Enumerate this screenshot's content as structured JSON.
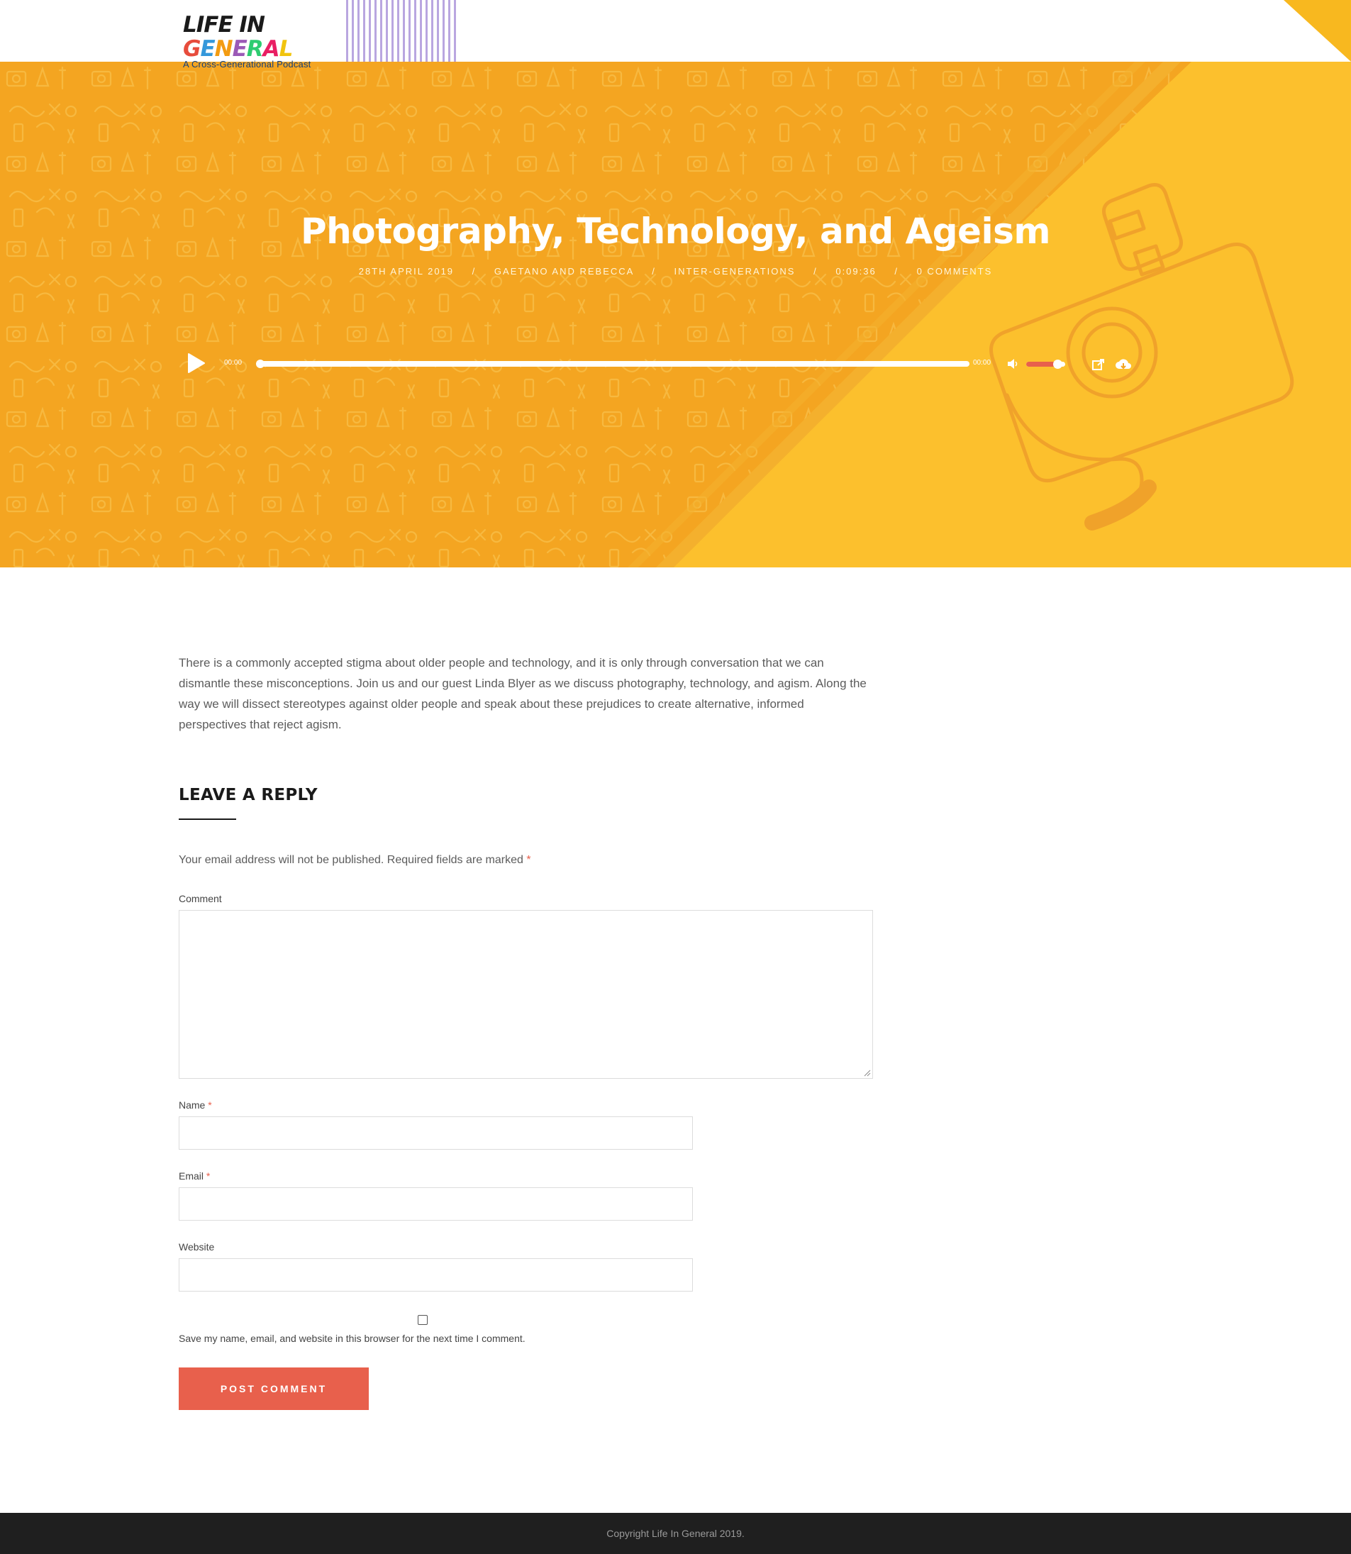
{
  "header": {
    "logo_title_parts": [
      "LIFE IN ",
      "G",
      "E",
      "N",
      "E",
      "R",
      "A",
      "L"
    ],
    "logo_subtitle": "A Cross-Generational Podcast"
  },
  "hero": {
    "title": "Photography, Technology, and Ageism",
    "meta": [
      "28TH APRIL 2019",
      "GAETANO AND REBECCA",
      "INTER-GENERATIONS",
      "0:09:36",
      "0 COMMENTS"
    ],
    "meta_separator": "/"
  },
  "player": {
    "current_time": "00:00",
    "duration": "00:00",
    "progress": 0,
    "volume": 0.8,
    "icons": [
      "play-icon",
      "mute-icon",
      "external-link-icon",
      "download-cloud-icon"
    ]
  },
  "post": {
    "intro": "There is a commonly accepted stigma about older people and technology, and it is only through conversation that we can dismantle these misconceptions. Join us and our guest Linda Blyer as we discuss photography, technology, and agism. Along the way we will dissect stereotypes against older people and speak about these prejudices to create alternative, informed perspectives that reject agism."
  },
  "reply": {
    "title": "LEAVE A REPLY",
    "notice": "Your email address will not be published. Required fields are marked",
    "required_mark": "*",
    "comment_label": "Comment",
    "comment_value": "",
    "name_label": "Name",
    "name_value": "",
    "email_label": "Email",
    "email_value": "",
    "website_label": "Website",
    "website_value": "",
    "save_label": "Save my name, email, and website in this browser for the next time I comment.",
    "save_checked": false,
    "submit_label": "POST COMMENT"
  },
  "footer": {
    "copyright": "Copyright Life In General 2019."
  },
  "colors": {
    "hero_bg": "#f4a521",
    "hero_accent": "#fcc02d",
    "button": "#e8604c",
    "footer_bg": "#1f1f1f",
    "stripes": "#b9a6e0"
  }
}
